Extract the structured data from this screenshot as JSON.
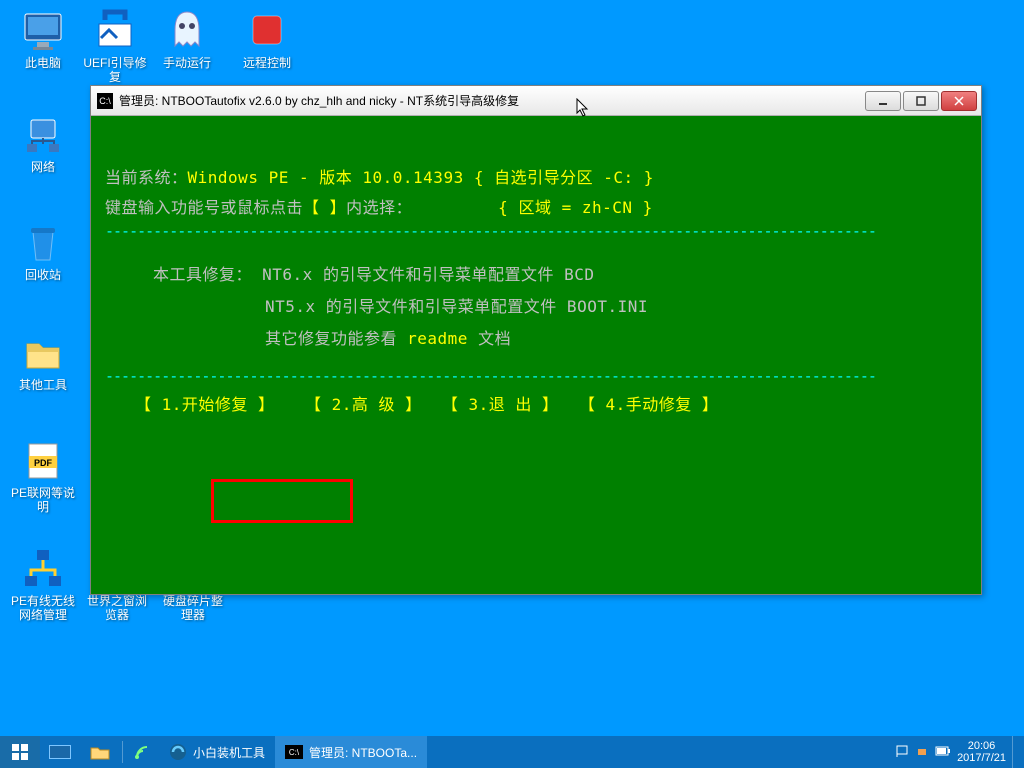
{
  "desktop": {
    "icons": [
      {
        "label": "此电脑",
        "key": "this-pc"
      },
      {
        "label": "UEFI引导修复",
        "key": "uefi"
      },
      {
        "label": "手动运行",
        "key": "ghost"
      },
      {
        "label": "远程控制",
        "key": "remote"
      },
      {
        "label": "网络",
        "key": "network"
      },
      {
        "label": "回收站",
        "key": "recycle"
      },
      {
        "label": "其他工具",
        "key": "other"
      },
      {
        "label": "PE联网等说明",
        "key": "pdf"
      },
      {
        "label": "PE有线无线网络管理",
        "key": "netmgr"
      },
      {
        "label": "世界之窗浏览器",
        "key": "browser"
      },
      {
        "label": "硬盘碎片整理器",
        "key": "defrag"
      }
    ]
  },
  "window": {
    "title": "管理员:  NTBOOTautofix v2.6.0 by chz_hlh and nicky - NT系统引导高级修复",
    "console": {
      "line1_prefix": "当前系统：",
      "line1_mid": "Windows PE - 版本 10.0.14393    ",
      "line1_brace": "{ 自选引导分区 -C: }",
      "line2_prefix": "键盘输入功能号或鼠标点击",
      "line2_brace": "【 】",
      "line2_suffix": "内选择：",
      "line2_region_label": "{ 区域 = ",
      "line2_region_val": "zh-CN",
      "line2_region_end": " }",
      "line3_prefix": "本工具修复：   ",
      "line3_a": "NT6.x 的引导文件和引导菜单配置文件 BCD",
      "line3_b": "NT5.x 的引导文件和引导菜单配置文件 BOOT.INI",
      "line3_c_prefix": "其它修复功能参看 ",
      "line3_c_mid": "readme",
      "line3_c_suffix": " 文档",
      "menu": {
        "opt1": "【 1.开始修复 】",
        "opt2": "【  2.高  级  】",
        "opt3": "【  3.退  出  】",
        "opt4": "【 4.手动修复 】"
      }
    }
  },
  "taskbar": {
    "app1": "小白装机工具",
    "app2": "管理员:  NTBOOTa...",
    "clock_time": "20:06",
    "clock_date": "2017/7/21"
  }
}
